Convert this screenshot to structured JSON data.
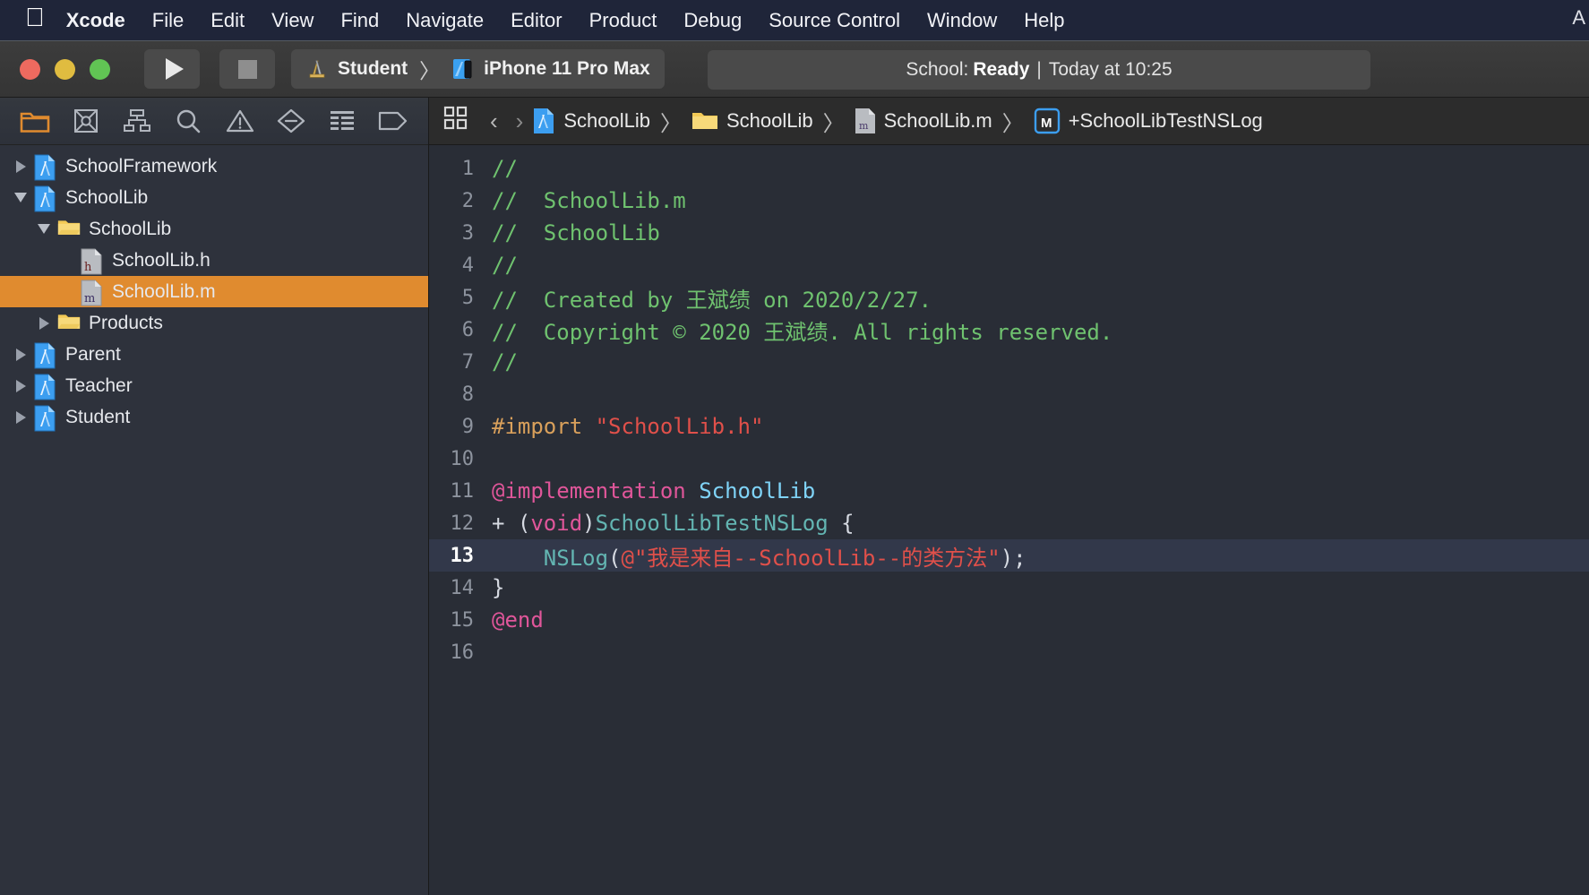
{
  "menubar": {
    "apple_icon": "apple-logo",
    "items": [
      {
        "label": "Xcode",
        "bold": true
      },
      {
        "label": "File"
      },
      {
        "label": "Edit"
      },
      {
        "label": "View"
      },
      {
        "label": "Find"
      },
      {
        "label": "Navigate"
      },
      {
        "label": "Editor"
      },
      {
        "label": "Product"
      },
      {
        "label": "Debug"
      },
      {
        "label": "Source Control"
      },
      {
        "label": "Window"
      },
      {
        "label": "Help"
      }
    ],
    "right_glyph": "A"
  },
  "toolbar": {
    "run_icon": "play-icon",
    "stop_icon": "stop-icon",
    "scheme": "Student",
    "scheme_separator": "〉",
    "destination": "iPhone 11 Pro Max",
    "status_prefix": "School:",
    "status_state": "Ready",
    "status_separator": "|",
    "status_time": "Today at 10:25"
  },
  "navigator": {
    "tabs": [
      {
        "name": "project-navigator-tab",
        "icon": "folder-icon",
        "active": true
      },
      {
        "name": "source-control-navigator-tab",
        "icon": "source-control-icon",
        "active": false
      },
      {
        "name": "symbol-navigator-tab",
        "icon": "hierarchy-icon",
        "active": false
      },
      {
        "name": "find-navigator-tab",
        "icon": "search-icon",
        "active": false
      },
      {
        "name": "issue-navigator-tab",
        "icon": "warning-triangle-icon",
        "active": false
      },
      {
        "name": "test-navigator-tab",
        "icon": "diamond-minus-icon",
        "active": false
      },
      {
        "name": "debug-navigator-tab",
        "icon": "report-lines-icon",
        "active": false
      },
      {
        "name": "breakpoint-navigator-tab",
        "icon": "tag-icon",
        "active": false
      }
    ],
    "tree": [
      {
        "label": "SchoolFramework",
        "depth": 0,
        "icon": "xcode-project-icon",
        "twisty": "right",
        "selected": false
      },
      {
        "label": "SchoolLib",
        "depth": 0,
        "icon": "xcode-project-icon",
        "twisty": "down",
        "selected": false
      },
      {
        "label": "SchoolLib",
        "depth": 1,
        "icon": "folder-icon",
        "twisty": "down",
        "selected": false
      },
      {
        "label": "SchoolLib.h",
        "depth": 2,
        "icon": "header-file-icon",
        "twisty": "none",
        "selected": false
      },
      {
        "label": "SchoolLib.m",
        "depth": 2,
        "icon": "impl-file-icon",
        "twisty": "none",
        "selected": true
      },
      {
        "label": "Products",
        "depth": 1,
        "icon": "folder-icon",
        "twisty": "right",
        "selected": false
      },
      {
        "label": "Parent",
        "depth": 0,
        "icon": "xcode-project-icon",
        "twisty": "right",
        "selected": false
      },
      {
        "label": "Teacher",
        "depth": 0,
        "icon": "xcode-project-icon",
        "twisty": "right",
        "selected": false
      },
      {
        "label": "Student",
        "depth": 0,
        "icon": "xcode-project-icon",
        "twisty": "right",
        "selected": false
      }
    ]
  },
  "jumpbar": {
    "related_items_icon": "grid-icon",
    "back_arrow": "‹",
    "forward_arrow": "›",
    "separator": "〉",
    "crumbs": [
      {
        "label": "SchoolLib",
        "icon": "xcode-project-icon"
      },
      {
        "label": "SchoolLib",
        "icon": "folder-icon"
      },
      {
        "label": "SchoolLib.m",
        "icon": "impl-file-icon"
      },
      {
        "label": "+SchoolLibTestNSLog",
        "icon": "method-m-icon"
      }
    ]
  },
  "editor": {
    "current_line": 13,
    "lines": [
      {
        "n": "1",
        "tokens": [
          {
            "t": "//",
            "c": "comment"
          }
        ]
      },
      {
        "n": "2",
        "tokens": [
          {
            "t": "//  SchoolLib.m",
            "c": "comment"
          }
        ]
      },
      {
        "n": "3",
        "tokens": [
          {
            "t": "//  SchoolLib",
            "c": "comment"
          }
        ]
      },
      {
        "n": "4",
        "tokens": [
          {
            "t": "//",
            "c": "comment"
          }
        ]
      },
      {
        "n": "5",
        "tokens": [
          {
            "t": "//  Created by 王斌绩 on 2020/2/27.",
            "c": "comment"
          }
        ]
      },
      {
        "n": "6",
        "tokens": [
          {
            "t": "//  Copyright © 2020 王斌绩. All rights reserved.",
            "c": "comment"
          }
        ]
      },
      {
        "n": "7",
        "tokens": [
          {
            "t": "//",
            "c": "comment"
          }
        ]
      },
      {
        "n": "8",
        "tokens": []
      },
      {
        "n": "9",
        "tokens": [
          {
            "t": "#import ",
            "c": "pre"
          },
          {
            "t": "\"SchoolLib.h\"",
            "c": "string"
          }
        ]
      },
      {
        "n": "10",
        "tokens": []
      },
      {
        "n": "11",
        "tokens": [
          {
            "t": "@implementation ",
            "c": "keyword"
          },
          {
            "t": "SchoolLib",
            "c": "type"
          }
        ]
      },
      {
        "n": "12",
        "tokens": [
          {
            "t": "+ (",
            "c": "plain"
          },
          {
            "t": "void",
            "c": "keyword"
          },
          {
            "t": ")",
            "c": "plain"
          },
          {
            "t": "SchoolLibTestNSLog",
            "c": "fn"
          },
          {
            "t": " {",
            "c": "plain"
          }
        ]
      },
      {
        "n": "13",
        "tokens": [
          {
            "t": "    ",
            "c": "plain"
          },
          {
            "t": "NSLog",
            "c": "fn"
          },
          {
            "t": "(",
            "c": "plain"
          },
          {
            "t": "@\"我是来自--SchoolLib--的类方法\"",
            "c": "string"
          },
          {
            "t": ");",
            "c": "plain"
          }
        ]
      },
      {
        "n": "14",
        "tokens": [
          {
            "t": "}",
            "c": "plain"
          }
        ]
      },
      {
        "n": "15",
        "tokens": [
          {
            "t": "@end",
            "c": "keyword"
          }
        ]
      },
      {
        "n": "16",
        "tokens": []
      }
    ]
  }
}
